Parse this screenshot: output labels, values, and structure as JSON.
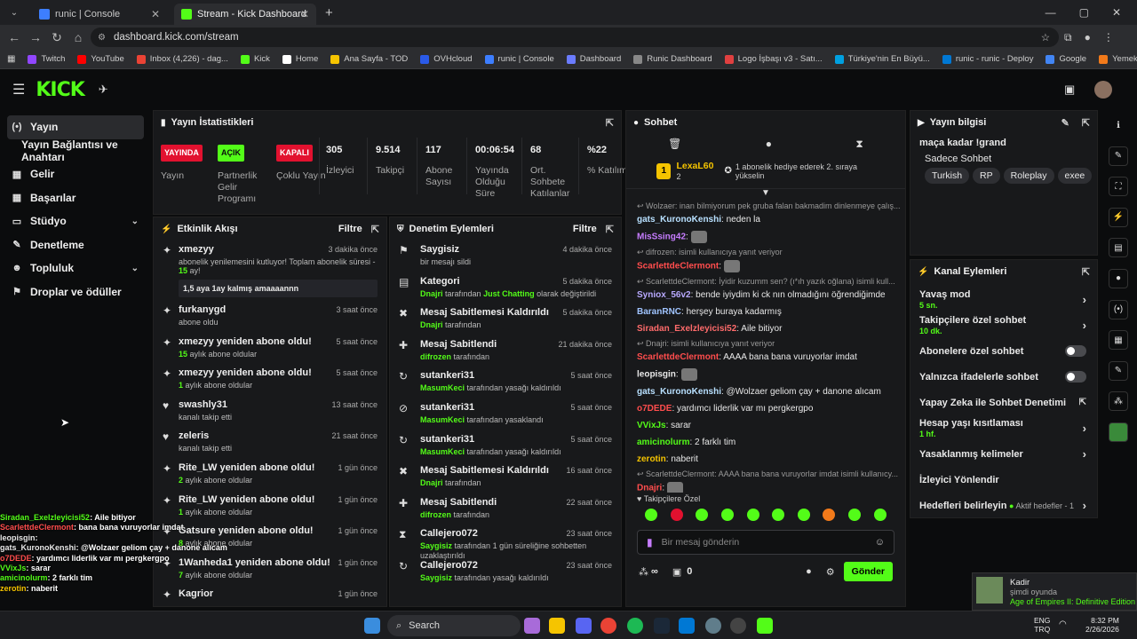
{
  "browser": {
    "tabs": [
      {
        "title": "runic | Console",
        "active": false,
        "favicon_color": "#3d7eff"
      },
      {
        "title": "Stream - Kick Dashboard",
        "active": true,
        "favicon_color": "#53fc18"
      }
    ],
    "new_tab": "+",
    "url": "dashboard.kick.com/stream",
    "bookmarks": [
      {
        "label": "Twitch",
        "color": "#9146ff"
      },
      {
        "label": "YouTube",
        "color": "#ff0000"
      },
      {
        "label": "Inbox (4,226) - dag...",
        "color": "#ea4335"
      },
      {
        "label": "Kick",
        "color": "#53fc18"
      },
      {
        "label": "Home",
        "color": "#ffffff"
      },
      {
        "label": "Ana Sayfa - TOD",
        "color": "#f5c400"
      },
      {
        "label": "OVHcloud",
        "color": "#2a5ae8"
      },
      {
        "label": "runic | Console",
        "color": "#3d7eff"
      },
      {
        "label": "Dashboard",
        "color": "#6b7cff"
      },
      {
        "label": "Runic Dashboard",
        "color": "#888888"
      },
      {
        "label": "Logo İşbaşı v3 - Satı...",
        "color": "#e04040"
      },
      {
        "label": "Türkiye'nin En Büyü...",
        "color": "#00a0e0"
      },
      {
        "label": "runic - runic - Deploy",
        "color": "#0078d4"
      },
      {
        "label": "Google",
        "color": "#4285f4"
      },
      {
        "label": "Yemek - Trendyol Go",
        "color": "#f27a1a"
      }
    ]
  },
  "sidebar": {
    "items": [
      {
        "label": "Yayın",
        "icon": "broadcast-icon",
        "glyph": "(•)",
        "active": true
      },
      {
        "label": "Yayın Bağlantısı ve Anahtarı",
        "icon": "",
        "glyph": "",
        "active": false
      },
      {
        "label": "Gelir",
        "icon": "revenue-icon",
        "glyph": "▦",
        "active": false
      },
      {
        "label": "Başarılar",
        "icon": "achievements-icon",
        "glyph": "▦",
        "active": false
      },
      {
        "label": "Stüdyo",
        "icon": "studio-icon",
        "glyph": "▭",
        "active": false,
        "chevron": true
      },
      {
        "label": "Denetleme",
        "icon": "wrench-icon",
        "glyph": "✎",
        "active": false
      },
      {
        "label": "Topluluk",
        "icon": "community-icon",
        "glyph": "☻",
        "active": false,
        "chevron": true
      },
      {
        "label": "Droplar ve ödüller",
        "icon": "drops-icon",
        "glyph": "⚑",
        "active": false
      }
    ]
  },
  "stats": {
    "title": "Yayın İstatistikleri",
    "badges": [
      {
        "tag": "YAYINDA",
        "label": "Yayın",
        "bg": "#e2112f",
        "fg": "#ffffff"
      },
      {
        "tag": "AÇIK",
        "label": "Partnerlik Gelir Programı",
        "bg": "#53fc18",
        "fg": "#0b0c0d"
      },
      {
        "tag": "KAPALI",
        "label": "Çoklu Yayın",
        "bg": "#e2112f",
        "fg": "#ffffff"
      }
    ],
    "numbers": [
      {
        "value": "305",
        "label": "İzleyici"
      },
      {
        "value": "9.514",
        "label": "Takipçi"
      },
      {
        "value": "117",
        "label": "Abone Sayısı"
      },
      {
        "value": "00:06:54",
        "label": "Yayında Olduğu Süre"
      },
      {
        "value": "68",
        "label": "Ort. Sohbete Katılanlar"
      },
      {
        "value": "%22",
        "label": "% Katılım"
      }
    ]
  },
  "activity": {
    "title": "Etkinlik Akışı",
    "filter": "Filtre",
    "events": [
      {
        "icon": "sparkle-icon",
        "glyph": "✦",
        "title": "xmezyy",
        "sub": "abonelik yenilemesini kutluyor! Toplam abonelik süresi - ",
        "green": "15",
        "sub2": " ay!",
        "time": "3 dakika önce",
        "message": "1,5 aya 1ay kalmış amaaaannn"
      },
      {
        "icon": "sparkle-icon",
        "glyph": "✦",
        "title": "furkanygd",
        "sub": "abone oldu",
        "time": "3 saat önce"
      },
      {
        "icon": "sparkle-icon",
        "glyph": "✦",
        "title": "xmezyy yeniden abone oldu!",
        "green": "15",
        "sub2": " aylık abone oldular",
        "time": "5 saat önce"
      },
      {
        "icon": "sparkle-icon",
        "glyph": "✦",
        "title": "xmezyy yeniden abone oldu!",
        "green": "1",
        "sub2": " aylık abone oldular",
        "time": "5 saat önce"
      },
      {
        "icon": "heart-icon",
        "glyph": "♥",
        "title": "swashly31",
        "sub": "kanalı takip etti",
        "time": "13 saat önce"
      },
      {
        "icon": "heart-icon",
        "glyph": "♥",
        "title": "zeleris",
        "sub": "kanalı takip etti",
        "time": "21 saat önce"
      },
      {
        "icon": "sparkle-icon",
        "glyph": "✦",
        "title": "Rite_LW yeniden abone oldu!",
        "green": "2",
        "sub2": " aylık abone oldular",
        "time": "1 gün önce"
      },
      {
        "icon": "sparkle-icon",
        "glyph": "✦",
        "title": "Rite_LW yeniden abone oldu!",
        "green": "1",
        "sub2": " aylık abone oldular",
        "time": "1 gün önce"
      },
      {
        "icon": "sparkle-icon",
        "glyph": "✦",
        "title": "Gatsure yeniden abone oldu!",
        "green": "8",
        "sub2": " aylık abone oldular",
        "time": "1 gün önce"
      },
      {
        "icon": "sparkle-icon",
        "glyph": "✦",
        "title": "1Wanheda1 yeniden abone oldu!",
        "green": "7",
        "sub2": " aylık abone oldular",
        "time": "1 gün önce"
      },
      {
        "icon": "sparkle-icon",
        "glyph": "✦",
        "title": "Kagrior",
        "sub": "",
        "time": "1 gün önce"
      }
    ]
  },
  "moderation": {
    "title": "Denetim Eylemleri",
    "filter": "Filtre",
    "events": [
      {
        "glyph": "⚑",
        "title": "Saygisiz",
        "pre": "",
        "green": "",
        "sub": "bir mesajı sildi",
        "time": "4 dakika önce"
      },
      {
        "glyph": "▤",
        "title": "Kategori",
        "pre": "",
        "green": "Dnajri",
        "sub": " tarafından ",
        "green2": "Just Chatting",
        "sub2": " olarak değiştirildi",
        "time": "5 dakika önce"
      },
      {
        "glyph": "✖",
        "title": "Mesaj Sabitlemesi Kaldırıldı",
        "green": "Dnajri",
        "sub": " tarafından",
        "time": "5 dakika önce"
      },
      {
        "glyph": "✚",
        "title": "Mesaj Sabitlendi",
        "green": "difrozen",
        "sub": " tarafından",
        "time": "21 dakika önce"
      },
      {
        "glyph": "↻",
        "title": "sutankeri31",
        "green": "MasumKeci",
        "sub": " tarafından yasağı kaldırıldı",
        "time": "5 saat önce"
      },
      {
        "glyph": "⊘",
        "title": "sutankeri31",
        "green": "MasumKeci",
        "sub": " tarafından yasaklandı",
        "time": "5 saat önce"
      },
      {
        "glyph": "↻",
        "title": "sutankeri31",
        "green": "MasumKeci",
        "sub": " tarafından yasağı kaldırıldı",
        "time": "5 saat önce"
      },
      {
        "glyph": "✖",
        "title": "Mesaj Sabitlemesi Kaldırıldı",
        "green": "Dnajri",
        "sub": " tarafından",
        "time": "16 saat önce"
      },
      {
        "glyph": "✚",
        "title": "Mesaj Sabitlendi",
        "green": "difrozen",
        "sub": " tarafından",
        "time": "22 saat önce"
      },
      {
        "glyph": "⧗",
        "title": "Callejero072",
        "green": "Saygisiz",
        "sub": " tarafından 1 gün süreliğine sohbetten uzaklaştırıldı",
        "time": "23 saat önce"
      },
      {
        "glyph": "↻",
        "title": "Callejero072",
        "green": "Saygisiz",
        "sub": " tarafından yasağı kaldırıldı",
        "time": "23 saat önce"
      }
    ]
  },
  "chat": {
    "title": "Sohbet",
    "top_user": "LexaL60",
    "top_user_count": "2",
    "top_rank": "1",
    "top_msg": "1 abonelik hediye ederek 2. sıraya yükselin",
    "lines": [
      {
        "type": "reply",
        "text": "Wolzaer: inan bilmiyorum pek gruba falan bakmadim dinlenmeye çalış..."
      },
      {
        "type": "msg",
        "user": "gats_KuronoKenshi",
        "color": "#b8e0ff",
        "text": ": neden la"
      },
      {
        "type": "msg",
        "user": "MisSsing42",
        "color": "#c77dff",
        "text": ":",
        "emote": true
      },
      {
        "type": "reply",
        "text": "difrozen:      isimli kullanıcıya yanıt veriyor"
      },
      {
        "type": "msg",
        "user": "ScarlettdeClermont",
        "color": "#ff4d4d",
        "text": ":",
        "emote": true
      },
      {
        "type": "reply",
        "text": "ScarlettdeClermont: İyidir kuzumm sen? (ı*ıh yazık oğlana) isimli kull..."
      },
      {
        "type": "msg",
        "user": "Syniox_56v2",
        "color": "#b8a9ff",
        "text": ":    bende iyiydim ki ck nın olmadığını öğrendiğimde"
      },
      {
        "type": "msg",
        "user": "BaranRNC",
        "color": "#a0c4ff",
        "text": ": herşey buraya kadarmış"
      },
      {
        "type": "msg",
        "user": "Siradan_Exelzleyicisi52",
        "color": "#ff6b6b",
        "text": ": Aile bitiyor"
      },
      {
        "type": "reply",
        "text": "Dnajri:      isimli kullanıcıya yanıt veriyor"
      },
      {
        "type": "msg",
        "user": "ScarlettdeClermont",
        "color": "#ff4d4d",
        "text": ": AAAA bana bana vuruyorlar imdat"
      },
      {
        "type": "msg",
        "user": "leopisgin",
        "color": "#e8e8e8",
        "text": ":",
        "emote": true
      },
      {
        "type": "msg",
        "user": "gats_KuronoKenshi",
        "color": "#b8e0ff",
        "text": ": @Wolzaer geliom çay + danone alıcam"
      },
      {
        "type": "msg",
        "user": "o7DEDE",
        "color": "#ff4d4d",
        "text": ": yardımcı liderlik var mı pergkergpo"
      },
      {
        "type": "msg",
        "user": "VVixJs",
        "color": "#53fc18",
        "text": ": sarar"
      },
      {
        "type": "msg",
        "user": "amicinolurm",
        "color": "#53fc18",
        "text": ": 2 farklı tim"
      },
      {
        "type": "msg",
        "user": "zerotin",
        "color": "#f5c400",
        "text": ": naberit"
      },
      {
        "type": "reply",
        "text": "ScarlettdeClermont: AAAA bana bana vuruyorlar imdat isimli kullanıcy..."
      },
      {
        "type": "msg",
        "user": "Dnajri",
        "color": "#ff4d4d",
        "text": ":",
        "emote": true
      }
    ],
    "emote_tab": "Takipçilere Özel",
    "input_placeholder": "Bir mesaj gönderin",
    "points": "∞",
    "gift_count": "0",
    "send": "Gönder"
  },
  "info": {
    "title": "Yayın bilgisi",
    "stream_title": "maça kadar !grand",
    "category": "Sadece Sohbet",
    "tags": [
      "Turkish",
      "RP",
      "Roleplay",
      "exee"
    ]
  },
  "actions": {
    "title": "Kanal Eylemleri",
    "rows": [
      {
        "label": "Yavaş mod",
        "sub": "5 sn.",
        "control": "arrow"
      },
      {
        "label": "Takipçilere özel sohbet",
        "sub": "10 dk.",
        "control": "arrow"
      },
      {
        "label": "Abonelere özel sohbet",
        "sub": "",
        "control": "toggle"
      },
      {
        "label": "Yalnızca ifadelerle sohbet",
        "sub": "",
        "control": "toggle"
      },
      {
        "label": "Yapay Zeka ile Sohbet Denetimi",
        "sub": "",
        "control": "ext"
      },
      {
        "label": "Hesap yaşı kısıtlaması",
        "sub": "1 hf.",
        "control": "arrow"
      },
      {
        "label": "Yasaklanmış kelimeler",
        "sub": "",
        "control": "arrow"
      },
      {
        "label": "İzleyici Yönlendir",
        "sub": "",
        "control": "none"
      },
      {
        "label": "Hedefleri belirleyin",
        "sub": "",
        "control": "arrow",
        "right_text": "Aktif hedefler - 1"
      }
    ]
  },
  "overlay_chat": [
    {
      "user": "Siradan_Exelzleyicisi52",
      "color": "#53fc18",
      "text": ": Aile bitiyor"
    },
    {
      "user": "ScarlettdeClermont",
      "color": "#ff4d4d",
      "text": ": bana bana vuruyorlar imdat"
    },
    {
      "user": "leopisgin",
      "color": "#e8e8e8",
      "text": ":"
    },
    {
      "user": "gats_KuronoKenshi",
      "color": "#e8e8e8",
      "text": ": @Wolzaer geliom çay + danone alıcam"
    },
    {
      "user": "o7DEDE",
      "color": "#ff4d4d",
      "text": ": yardımcı liderlik var mı pergkergpo"
    },
    {
      "user": "VVixJs",
      "color": "#53fc18",
      "text": ": sarar"
    },
    {
      "user": "amicinolurm",
      "color": "#53fc18",
      "text": ": 2 farklı tim"
    },
    {
      "user": "zerotin",
      "color": "#f5c400",
      "text": ": naberit"
    }
  ],
  "notification": {
    "name": "Kadir",
    "status": "şimdi oyunda",
    "game": "Age of Empires II: Definitive Edition"
  },
  "taskbar": {
    "search": "Search",
    "lang": "ENG",
    "lang2": "TRQ",
    "time": "8:32 PM",
    "date": "2/26/2026"
  }
}
